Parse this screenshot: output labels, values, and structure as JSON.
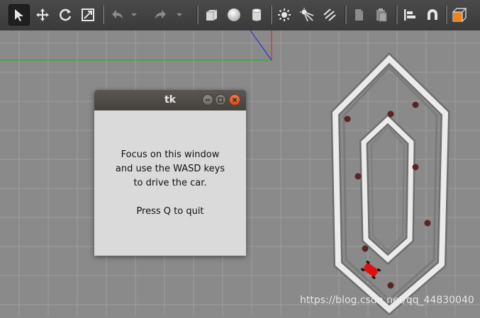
{
  "toolbar": {
    "tools": [
      {
        "name": "select-arrow-icon"
      },
      {
        "name": "translate-icon"
      },
      {
        "name": "rotate-icon"
      },
      {
        "name": "scale-icon"
      },
      {
        "name": "undo-icon"
      },
      {
        "name": "redo-icon"
      },
      {
        "name": "box-shape-icon"
      },
      {
        "name": "sphere-shape-icon"
      },
      {
        "name": "cylinder-shape-icon"
      },
      {
        "name": "point-light-icon"
      },
      {
        "name": "spot-light-icon"
      },
      {
        "name": "directional-light-icon"
      },
      {
        "name": "copy-icon"
      },
      {
        "name": "paste-icon"
      },
      {
        "name": "align-icon"
      },
      {
        "name": "snap-magnet-icon"
      },
      {
        "name": "view-angle-icon"
      }
    ],
    "colors": {
      "accent_orange": "#f0851e",
      "icon_light": "#e6e6e6",
      "icon_dim": "#8c8c8c"
    }
  },
  "scene": {
    "background": "#8a8a8a",
    "grid_color": "#9c9c9c",
    "axis_x_color": "#d92020",
    "axis_y_color": "#20b020",
    "axis_z_color": "#2020e0",
    "track_color": "#e8e8e8",
    "car_color": "#e01010",
    "obstacle_color": "#5a2424"
  },
  "dialog": {
    "title": "tk",
    "line1": "Focus on this window",
    "line2": "and use the WASD keys",
    "line3": "to drive the car.",
    "line4": "Press Q to quit"
  },
  "watermark": "https://blog.csdn.net/qq_44830040"
}
